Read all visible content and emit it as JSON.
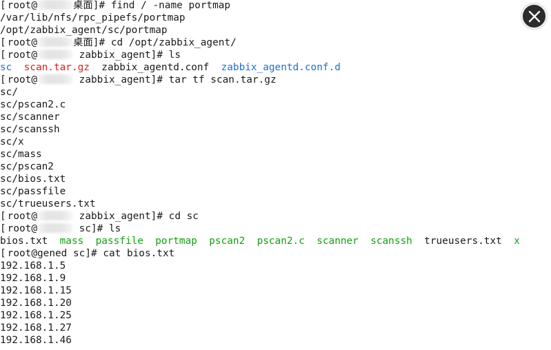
{
  "terminal": {
    "prompt_user": "root@",
    "prompt_user_host": "root@gened",
    "dir_desktop": "桌面",
    "dir_agent": "zabbix_agent",
    "dir_sc": "sc",
    "hash": "#",
    "cmd_find": "find / -name portmap",
    "find_result_1": "/var/lib/nfs/rpc_pipefs/portmap",
    "find_result_2": "/opt/zabbix_agent/sc/portmap",
    "cmd_cd_agent": "cd /opt/zabbix_agent/",
    "cmd_ls": "ls",
    "ls1": [
      "sc",
      "scan.tar.gz",
      "zabbix_agentd.conf",
      "zabbix_agentd.conf.d"
    ],
    "cmd_tar": "tar tf scan.tar.gz",
    "tar_list": [
      "sc/",
      "sc/pscan2.c",
      "sc/scanner",
      "sc/scanssh",
      "sc/x",
      "sc/mass",
      "sc/pscan2",
      "sc/bios.txt",
      "sc/passfile",
      "sc/trueusers.txt"
    ],
    "cmd_cd_sc": "cd sc",
    "ls2": [
      "bios.txt",
      "mass",
      "passfile",
      "portmap",
      "pscan2",
      "pscan2.c",
      "scanner",
      "scanssh",
      "trueusers.txt",
      "x"
    ],
    "cmd_cat": "cat bios.txt",
    "bios_ips": [
      "192.168.1.5",
      "192.168.1.9",
      "192.168.1.15",
      "192.168.1.20",
      "192.168.1.25",
      "192.168.1.27",
      "192.168.1.46"
    ]
  },
  "colors": {
    "directory": "#1e6fd0",
    "archive": "#d42020",
    "executable": "#11a011",
    "close_button_bg": "#2b2b2b"
  },
  "close_icon": "close-icon"
}
